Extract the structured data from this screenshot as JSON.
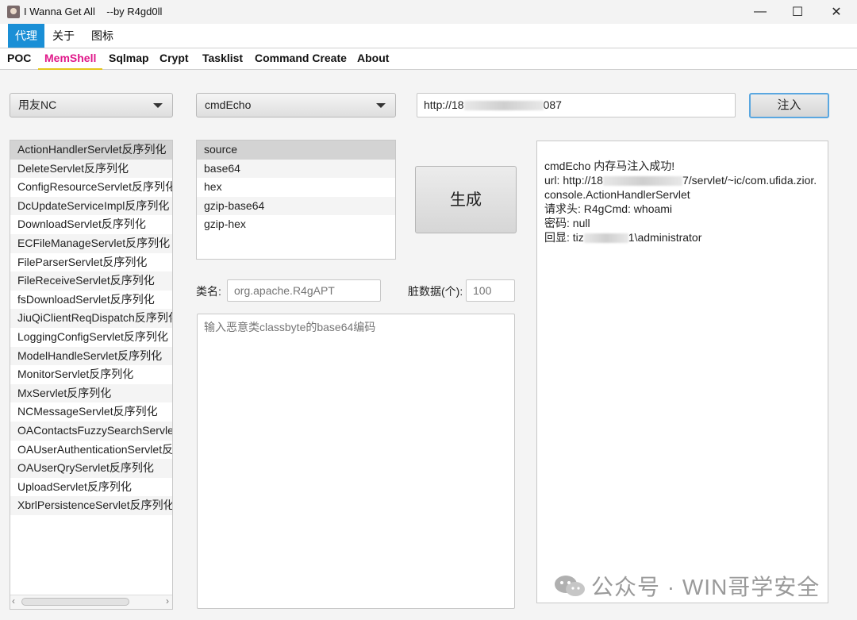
{
  "window": {
    "title": "I Wanna Get All    --by R4gd0ll",
    "minimize": "—",
    "maximize": "☐",
    "close": "✕"
  },
  "menu": [
    "代理",
    "关于",
    "图标"
  ],
  "tabs": [
    "POC",
    "MemShell",
    "Sqlmap",
    "Crypt",
    "Tasklist",
    "Command Create",
    "About"
  ],
  "target_combo": {
    "selected": "用友NC"
  },
  "type_combo": {
    "selected": "cmdEcho"
  },
  "url_field": {
    "value_prefix": "http://18",
    "value_suffix": "087"
  },
  "inject_button": "注入",
  "vuln_list": [
    "ActionHandlerServlet反序列化",
    "DeleteServlet反序列化",
    "ConfigResourceServlet反序列化",
    "DcUpdateServiceImpl反序列化",
    "DownloadServlet反序列化",
    "ECFileManageServlet反序列化",
    "FileParserServlet反序列化",
    "FileReceiveServlet反序列化",
    "fsDownloadServlet反序列化",
    "JiuQiClientReqDispatch反序列化",
    "LoggingConfigServlet反序列化",
    "ModelHandleServlet反序列化",
    "MonitorServlet反序列化",
    "MxServlet反序列化",
    "NCMessageServlet反序列化",
    "OAContactsFuzzySearchServlet反序列化",
    "OAUserAuthenticationServlet反序列化",
    "OAUserQryServlet反序列化",
    "UploadServlet反序列化",
    "XbrlPersistenceServlet反序列化"
  ],
  "format_list": [
    "source",
    "base64",
    "hex",
    "gzip-base64",
    "gzip-hex"
  ],
  "generate_button": "生成",
  "classname": {
    "label": "类名:",
    "placeholder": "org.apache.R4gAPT"
  },
  "dirty": {
    "label": "脏数据(个):",
    "placeholder": "100"
  },
  "classbyte": {
    "placeholder": "输入恶意类classbyte的base64编码"
  },
  "output": {
    "line1": "cmdEcho 内存马注入成功!",
    "line2_prefix": "url: http://18",
    "line2_suffix": "7/servlet/~ic/com.ufida.zior.",
    "line3": "console.ActionHandlerServlet",
    "line4": "请求头: R4gCmd: whoami",
    "line5": "密码: null",
    "line6_prefix": "回显: tiz",
    "line6_suffix": "1\\administrator"
  },
  "watermark": "公众号 · WIN哥学安全"
}
